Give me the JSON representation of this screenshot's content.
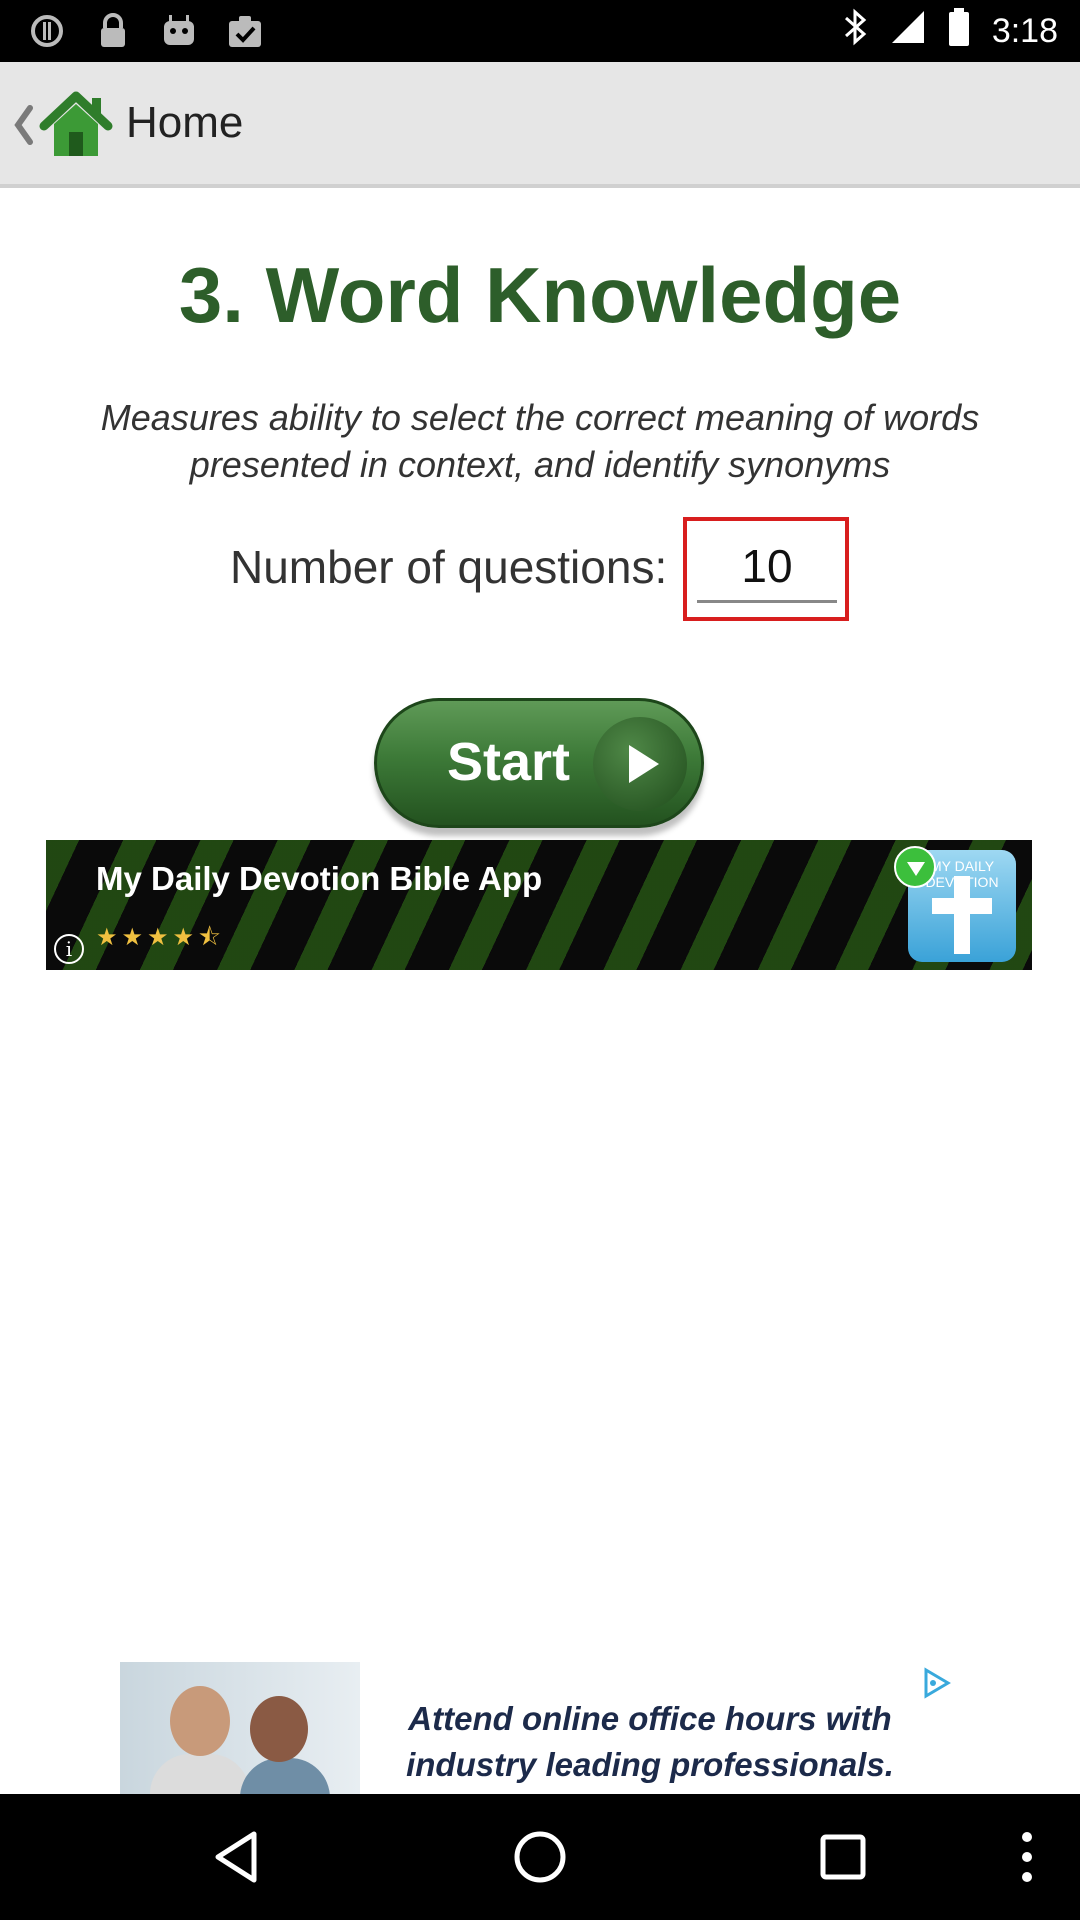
{
  "status_bar": {
    "time": "3:18",
    "left_icons": [
      "alert-circle-icon",
      "lock-icon",
      "android-icon",
      "clipboard-check-icon"
    ],
    "right_icons": [
      "bluetooth-icon",
      "signal-icon",
      "battery-icon"
    ]
  },
  "app_bar": {
    "title": "Home",
    "back_icon": "chevron-left-icon",
    "home_icon": "house-icon"
  },
  "main": {
    "heading": "3. Word Knowledge",
    "description": "Measures ability to select the correct meaning of words presented in context, and identify synonyms",
    "questions_label": "Number of questions:",
    "questions_value": "10",
    "start_label": "Start"
  },
  "ad_banner": {
    "title": "My Daily Devotion Bible App",
    "rating": 4.5,
    "rating_max": 5,
    "stars_text": "★★★★⯪",
    "icon_text": "MY DAILY DEVOTION"
  },
  "bottom_ad": {
    "line1": "Attend online office hours with",
    "line2": "industry leading professionals."
  },
  "nav_bar": {
    "buttons": [
      "back-triangle-icon",
      "home-circle-icon",
      "recents-square-icon",
      "overflow-dots-icon"
    ]
  }
}
